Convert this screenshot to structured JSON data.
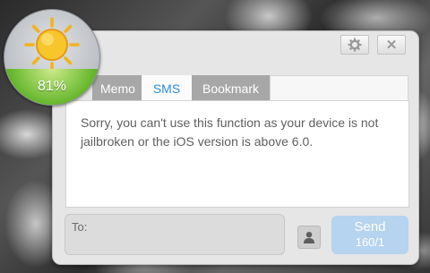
{
  "weather_widget": {
    "percentage": "81%",
    "sun_icon": "sun-icon"
  },
  "window": {
    "settings_icon": "gear-icon",
    "close_icon": "close-icon",
    "close_glyph": "✕"
  },
  "tabs": [
    {
      "label": "Memo",
      "active": false
    },
    {
      "label": "SMS",
      "active": true
    },
    {
      "label": "Bookmark",
      "active": false
    }
  ],
  "message": "Sorry, you can't use this function as your device is not jailbroken or the iOS version is above 6.0.",
  "compose": {
    "to_label": "To:",
    "contact_icon": "person-icon",
    "send_label": "Send",
    "send_count": "160/1"
  },
  "colors": {
    "accent": "#2a8fd8",
    "send_button": "#b6d3ef",
    "inactive_tab": "#a7a7a7"
  }
}
